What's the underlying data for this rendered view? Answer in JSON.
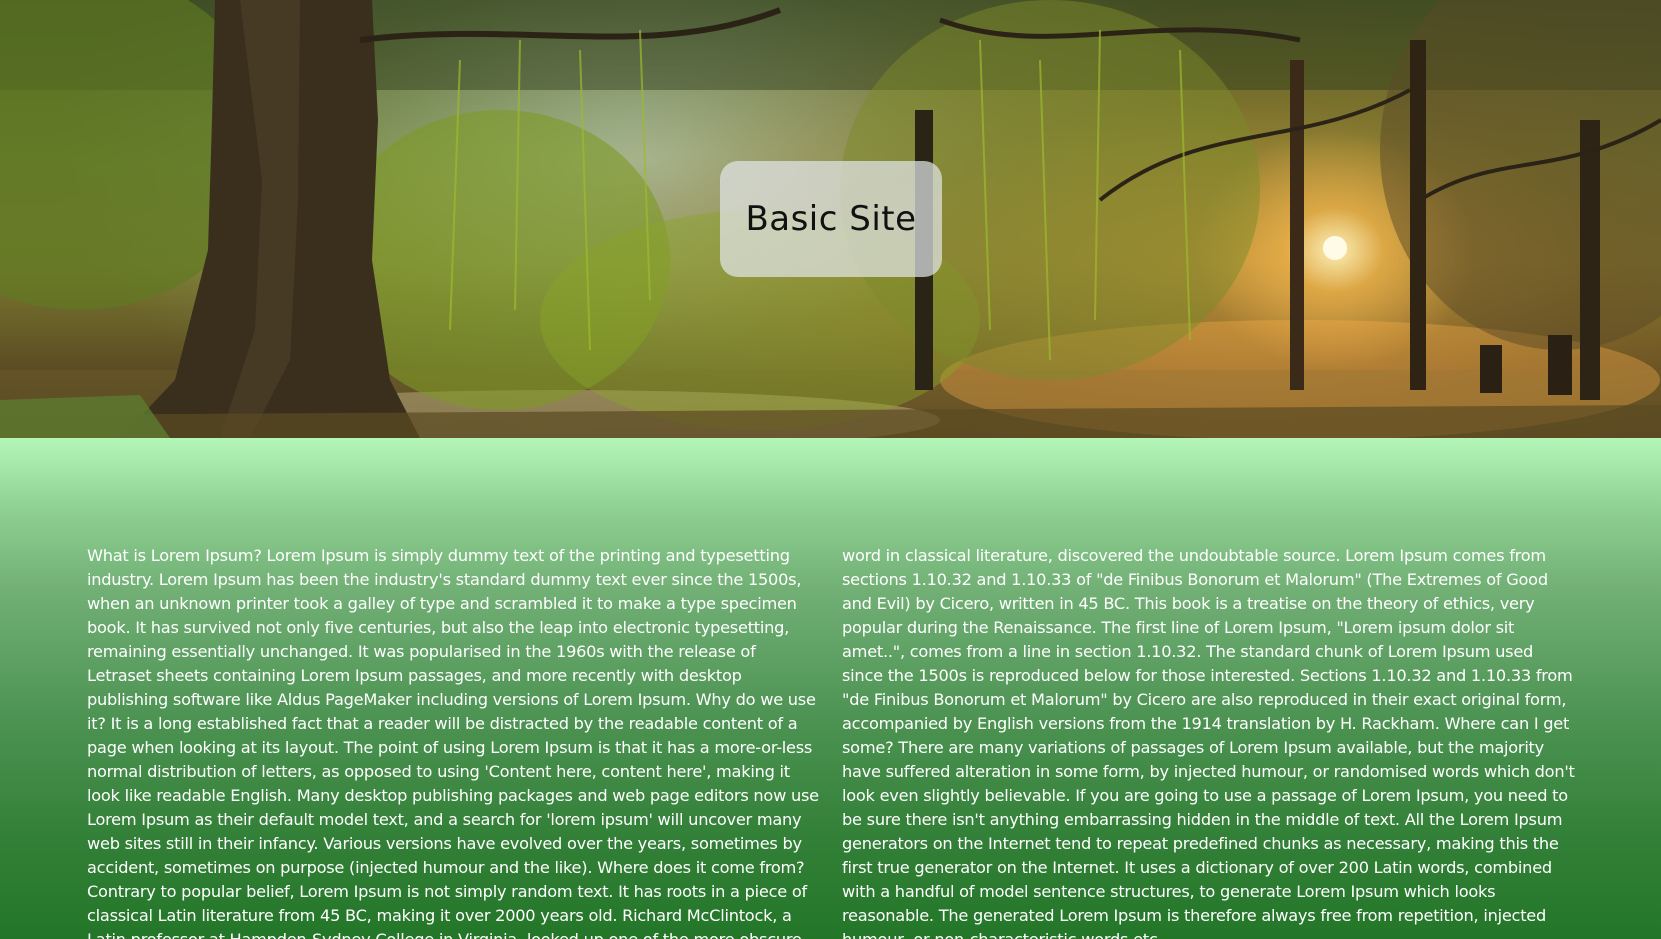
{
  "site": {
    "title": "Basic Site"
  },
  "hero": {
    "image": "forest-sunrise-trees-image"
  },
  "content": {
    "body": "What is Lorem Ipsum? Lorem Ipsum is simply dummy text of the printing and typesetting industry. Lorem Ipsum has been the industry's standard dummy text ever since the 1500s, when an unknown printer took a galley of type and scrambled it to make a type specimen book. It has survived not only five centuries, but also the leap into electronic typesetting, remaining essentially unchanged. It was popularised in the 1960s with the release of Letraset sheets containing Lorem Ipsum passages, and more recently with desktop publishing software like Aldus PageMaker including versions of Lorem Ipsum. Why do we use it? It is a long established fact that a reader will be distracted by the readable content of a page when looking at its layout. The point of using Lorem Ipsum is that it has a more-or-less normal distribution of letters, as opposed to using 'Content here, content here', making it look like readable English. Many desktop publishing packages and web page editors now use Lorem Ipsum as their default model text, and a search for 'lorem ipsum' will uncover many web sites still in their infancy. Various versions have evolved over the years, sometimes by accident, sometimes on purpose (injected humour and the like). Where does it come from? Contrary to popular belief, Lorem Ipsum is not simply random text. It has roots in a piece of classical Latin literature from 45 BC, making it over 2000 years old. Richard McClintock, a Latin professor at Hampden-Sydney College in Virginia, looked up one of the more obscure Latin words, consectetur, from a Lorem Ipsum passage, and going through the cites of the word in classical literature, discovered the undoubtable source. Lorem Ipsum comes from sections 1.10.32 and 1.10.33 of \"de Finibus Bonorum et Malorum\" (The Extremes of Good and Evil) by Cicero, written in 45 BC. This book is a treatise on the theory of ethics, very popular during the Renaissance. The first line of Lorem Ipsum, \"Lorem ipsum dolor sit amet..\", comes from a line in section 1.10.32. The standard chunk of Lorem Ipsum used since the 1500s is reproduced below for those interested. Sections 1.10.32 and 1.10.33 from \"de Finibus Bonorum et Malorum\" by Cicero are also reproduced in their exact original form, accompanied by English versions from the 1914 translation by H. Rackham. Where can I get some? There are many variations of passages of Lorem Ipsum available, but the majority have suffered alteration in some form, by injected humour, or randomised words which don't look even slightly believable. If you are going to use a passage of Lorem Ipsum, you need to be sure there isn't anything embarrassing hidden in the middle of text. All the Lorem Ipsum generators on the Internet tend to repeat predefined chunks as necessary, making this the first true generator on the Internet. It uses a dictionary of over 200 Latin words, combined with a handful of model sentence structures, to generate Lorem Ipsum which looks reasonable. The generated Lorem Ipsum is therefore always free from repetition, injected humour, or non-characteristic words etc."
  }
}
